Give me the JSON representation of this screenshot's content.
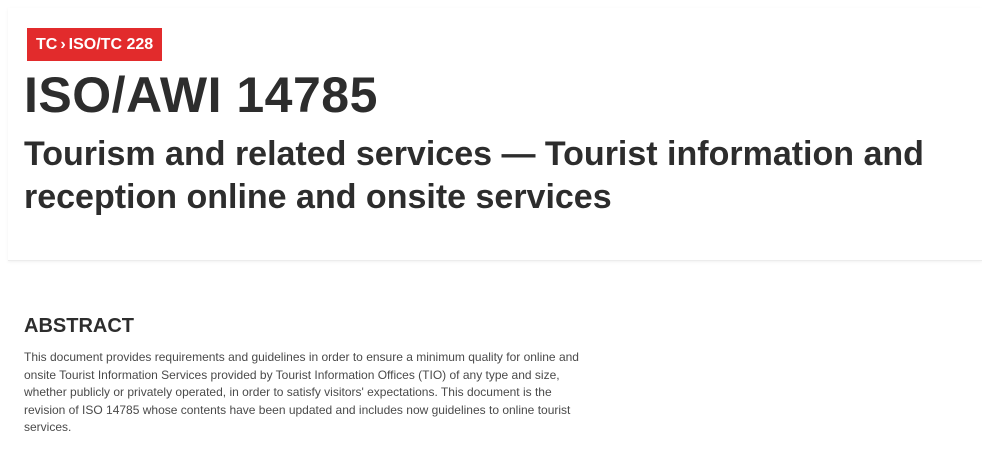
{
  "breadcrumb": {
    "items": [
      "TC",
      "ISO/TC 228"
    ],
    "separator": "›"
  },
  "document": {
    "title": "ISO/AWI 14785",
    "subtitle": "Tourism and related services — Tourist information and reception online and onsite services"
  },
  "abstract": {
    "heading": "ABSTRACT",
    "text": "This document provides requirements and guidelines in order to ensure a minimum quality for online and onsite Tourist Information Services provided by Tourist Information Offices (TIO) of any type and size, whether publicly or privately operated, in order to satisfy visitors' expectations. This document is the revision of ISO 14785 whose contents have been updated and includes now guidelines to online tourist services."
  },
  "colors": {
    "breadcrumb_bg": "#e22b2c",
    "title": "#2d2d2d",
    "body_text": "#4a4a4a"
  }
}
